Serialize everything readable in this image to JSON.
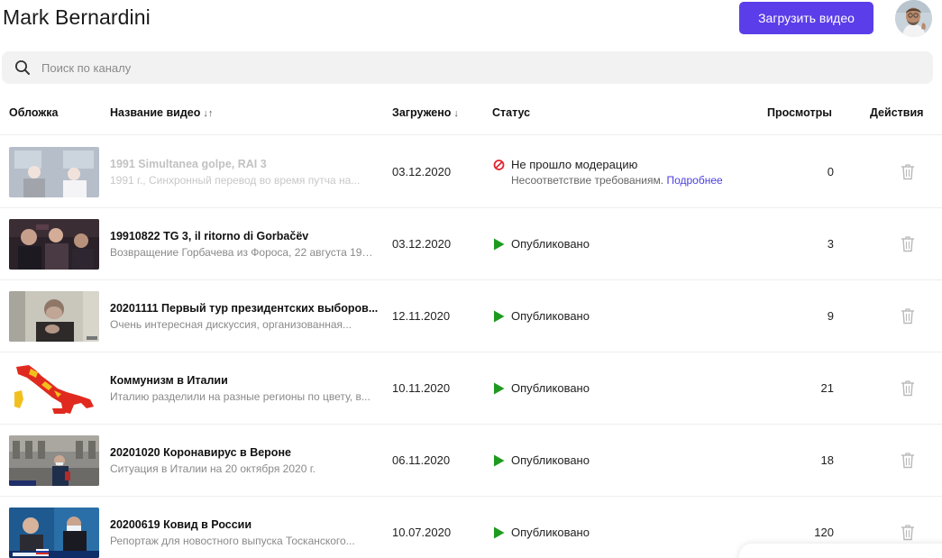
{
  "header": {
    "channel_name": "Mark Bernardini",
    "upload_button": "Загрузить видео"
  },
  "search": {
    "placeholder": "Поиск по каналу"
  },
  "table": {
    "columns": {
      "cover": "Обложка",
      "title": "Название видео",
      "title_sort": "↓↑",
      "uploaded": "Загружено",
      "uploaded_sort": "↓",
      "status": "Статус",
      "views": "Просмотры",
      "actions": "Действия"
    },
    "rows": [
      {
        "title": "1991 Simultanea golpe, RAI 3",
        "description": "1991 г., Синхронный перевод во время путча на...",
        "date": "03.12.2020",
        "status": "Не прошло модерацию",
        "status_type": "rejected",
        "status_detail": "Несоответствие требованиям.",
        "status_link": "Подробнее",
        "views": "0"
      },
      {
        "title": "19910822 TG 3, il ritorno di Gorbačëv",
        "description": "Возвращение Горбачева из Фороса, 22 августа 1991...",
        "date": "03.12.2020",
        "status": "Опубликовано",
        "status_type": "published",
        "views": "3"
      },
      {
        "title": "20201111 Первый тур президентских выборов...",
        "description": "Очень интересная дискуссия, организованная...",
        "date": "12.11.2020",
        "status": "Опубликовано",
        "status_type": "published",
        "views": "9"
      },
      {
        "title": "Коммунизм в Италии",
        "description": "Италию разделили на разные регионы по цвету, в...",
        "date": "10.11.2020",
        "status": "Опубликовано",
        "status_type": "published",
        "views": "21"
      },
      {
        "title": "20201020 Коронавирус в Вероне",
        "description": "Ситуация в Италии на 20 октября 2020 г.",
        "date": "06.11.2020",
        "status": "Опубликовано",
        "status_type": "published",
        "views": "18"
      },
      {
        "title": "20200619 Ковид в России",
        "description": "Репортаж для новостного выпуска Тосканского...",
        "date": "10.07.2020",
        "status": "Опубликовано",
        "status_type": "published",
        "views": "120"
      }
    ]
  },
  "colors": {
    "accent": "#5b3ee9",
    "published": "#1e9b1e",
    "rejected": "#e0262f",
    "link": "#4a3fe0"
  },
  "icons": {
    "search": "search-icon",
    "published": "play-triangle-icon",
    "rejected": "prohibited-icon",
    "delete": "trash-icon"
  }
}
